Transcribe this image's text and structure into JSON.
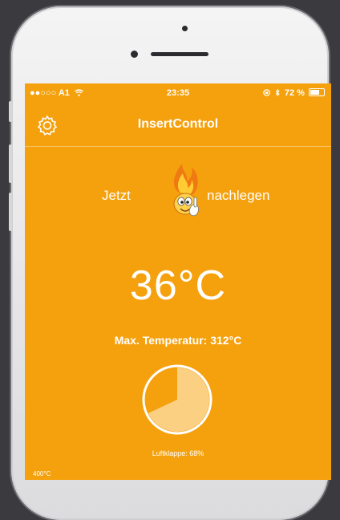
{
  "status_bar": {
    "carrier": "●●○○○ A1",
    "time": "23:35",
    "battery": "72 %"
  },
  "nav": {
    "title": "InsertControl",
    "settings_icon": "gear-icon"
  },
  "refuel": {
    "prefix": "Jetzt",
    "suffix": "nachlegen",
    "mascot_icon": "flame-mascot-icon"
  },
  "temperature": {
    "current": "36°C",
    "max_label": "Max. Temperatur: 312°C"
  },
  "damper": {
    "label": "Luftklappe: 68%",
    "percent": 68
  },
  "footnote": "400°C",
  "colors": {
    "background": "#f5a10e",
    "text": "#ffffff"
  }
}
